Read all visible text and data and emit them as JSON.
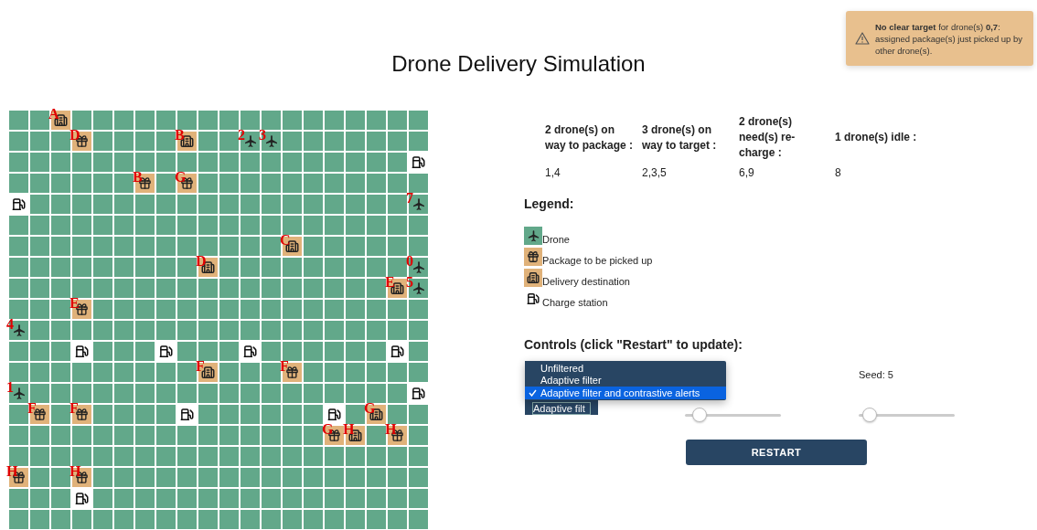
{
  "toast": {
    "message": "**No clear target** for drone(s) **0,7**: assigned package(s) just picked up by other drone(s)."
  },
  "title": "Drone Delivery Simulation",
  "grid": [
    [
      {
        "kind": "field"
      },
      {
        "kind": "field"
      },
      {
        "kind": "destination",
        "label": "A"
      },
      {
        "kind": "field"
      },
      {
        "kind": "field"
      },
      {
        "kind": "field"
      },
      {
        "kind": "field"
      },
      {
        "kind": "field"
      },
      {
        "kind": "field"
      },
      {
        "kind": "field"
      },
      {
        "kind": "field"
      },
      {
        "kind": "field"
      },
      {
        "kind": "field"
      },
      {
        "kind": "field"
      },
      {
        "kind": "field"
      },
      {
        "kind": "field"
      },
      {
        "kind": "field"
      },
      {
        "kind": "field"
      },
      {
        "kind": "field"
      },
      {
        "kind": "field"
      }
    ],
    [
      {
        "kind": "field"
      },
      {
        "kind": "field"
      },
      {
        "kind": "field"
      },
      {
        "kind": "package",
        "label": "D"
      },
      {
        "kind": "field"
      },
      {
        "kind": "field"
      },
      {
        "kind": "field"
      },
      {
        "kind": "field"
      },
      {
        "kind": "destination",
        "label": "B"
      },
      {
        "kind": "field"
      },
      {
        "kind": "field"
      },
      {
        "kind": "drone",
        "label": "2"
      },
      {
        "kind": "drone",
        "label": "3"
      },
      {
        "kind": "field"
      },
      {
        "kind": "field"
      },
      {
        "kind": "field"
      },
      {
        "kind": "field"
      },
      {
        "kind": "field"
      },
      {
        "kind": "field"
      },
      {
        "kind": "field"
      }
    ],
    [
      {
        "kind": "field"
      },
      {
        "kind": "field"
      },
      {
        "kind": "field"
      },
      {
        "kind": "field"
      },
      {
        "kind": "field"
      },
      {
        "kind": "field"
      },
      {
        "kind": "field"
      },
      {
        "kind": "field"
      },
      {
        "kind": "field"
      },
      {
        "kind": "field"
      },
      {
        "kind": "field"
      },
      {
        "kind": "field"
      },
      {
        "kind": "field"
      },
      {
        "kind": "field"
      },
      {
        "kind": "field"
      },
      {
        "kind": "field"
      },
      {
        "kind": "field"
      },
      {
        "kind": "field"
      },
      {
        "kind": "field"
      },
      {
        "kind": "charge"
      }
    ],
    [
      {
        "kind": "field"
      },
      {
        "kind": "field"
      },
      {
        "kind": "field"
      },
      {
        "kind": "field"
      },
      {
        "kind": "field"
      },
      {
        "kind": "field"
      },
      {
        "kind": "package",
        "label": "B"
      },
      {
        "kind": "field"
      },
      {
        "kind": "package",
        "label": "G"
      },
      {
        "kind": "field"
      },
      {
        "kind": "field"
      },
      {
        "kind": "field"
      },
      {
        "kind": "field"
      },
      {
        "kind": "field"
      },
      {
        "kind": "field"
      },
      {
        "kind": "field"
      },
      {
        "kind": "field"
      },
      {
        "kind": "field"
      },
      {
        "kind": "field"
      },
      {
        "kind": "field"
      }
    ],
    [
      {
        "kind": "charge"
      },
      {
        "kind": "field"
      },
      {
        "kind": "field"
      },
      {
        "kind": "field"
      },
      {
        "kind": "field"
      },
      {
        "kind": "field"
      },
      {
        "kind": "field"
      },
      {
        "kind": "field"
      },
      {
        "kind": "field"
      },
      {
        "kind": "field"
      },
      {
        "kind": "field"
      },
      {
        "kind": "field"
      },
      {
        "kind": "field"
      },
      {
        "kind": "field"
      },
      {
        "kind": "field"
      },
      {
        "kind": "field"
      },
      {
        "kind": "field"
      },
      {
        "kind": "field"
      },
      {
        "kind": "field"
      },
      {
        "kind": "drone",
        "label": "7"
      }
    ],
    [
      {
        "kind": "field"
      },
      {
        "kind": "field"
      },
      {
        "kind": "field"
      },
      {
        "kind": "field"
      },
      {
        "kind": "field"
      },
      {
        "kind": "field"
      },
      {
        "kind": "field"
      },
      {
        "kind": "field"
      },
      {
        "kind": "field"
      },
      {
        "kind": "field"
      },
      {
        "kind": "field"
      },
      {
        "kind": "field"
      },
      {
        "kind": "field"
      },
      {
        "kind": "field"
      },
      {
        "kind": "field"
      },
      {
        "kind": "field"
      },
      {
        "kind": "field"
      },
      {
        "kind": "field"
      },
      {
        "kind": "field"
      },
      {
        "kind": "field"
      }
    ],
    [
      {
        "kind": "field"
      },
      {
        "kind": "field"
      },
      {
        "kind": "field"
      },
      {
        "kind": "field"
      },
      {
        "kind": "field"
      },
      {
        "kind": "field"
      },
      {
        "kind": "field"
      },
      {
        "kind": "field"
      },
      {
        "kind": "field"
      },
      {
        "kind": "field"
      },
      {
        "kind": "field"
      },
      {
        "kind": "field"
      },
      {
        "kind": "field"
      },
      {
        "kind": "destination",
        "label": "C"
      },
      {
        "kind": "field"
      },
      {
        "kind": "field"
      },
      {
        "kind": "field"
      },
      {
        "kind": "field"
      },
      {
        "kind": "field"
      },
      {
        "kind": "field"
      }
    ],
    [
      {
        "kind": "field"
      },
      {
        "kind": "field"
      },
      {
        "kind": "field"
      },
      {
        "kind": "field"
      },
      {
        "kind": "field"
      },
      {
        "kind": "field"
      },
      {
        "kind": "field"
      },
      {
        "kind": "field"
      },
      {
        "kind": "field"
      },
      {
        "kind": "destination",
        "label": "D"
      },
      {
        "kind": "field"
      },
      {
        "kind": "field"
      },
      {
        "kind": "field"
      },
      {
        "kind": "field"
      },
      {
        "kind": "field"
      },
      {
        "kind": "field"
      },
      {
        "kind": "field"
      },
      {
        "kind": "field"
      },
      {
        "kind": "field"
      },
      {
        "kind": "drone",
        "label": "0"
      }
    ],
    [
      {
        "kind": "field"
      },
      {
        "kind": "field"
      },
      {
        "kind": "field"
      },
      {
        "kind": "field"
      },
      {
        "kind": "field"
      },
      {
        "kind": "field"
      },
      {
        "kind": "field"
      },
      {
        "kind": "field"
      },
      {
        "kind": "field"
      },
      {
        "kind": "field"
      },
      {
        "kind": "field"
      },
      {
        "kind": "field"
      },
      {
        "kind": "field"
      },
      {
        "kind": "field"
      },
      {
        "kind": "field"
      },
      {
        "kind": "field"
      },
      {
        "kind": "field"
      },
      {
        "kind": "field"
      },
      {
        "kind": "destination",
        "label": "E"
      },
      {
        "kind": "drone",
        "label": "5"
      }
    ],
    [
      {
        "kind": "field"
      },
      {
        "kind": "field"
      },
      {
        "kind": "field"
      },
      {
        "kind": "package",
        "label": "E"
      },
      {
        "kind": "field"
      },
      {
        "kind": "field"
      },
      {
        "kind": "field"
      },
      {
        "kind": "field"
      },
      {
        "kind": "field"
      },
      {
        "kind": "field"
      },
      {
        "kind": "field"
      },
      {
        "kind": "field"
      },
      {
        "kind": "field"
      },
      {
        "kind": "field"
      },
      {
        "kind": "field"
      },
      {
        "kind": "field"
      },
      {
        "kind": "field"
      },
      {
        "kind": "field"
      },
      {
        "kind": "field"
      },
      {
        "kind": "field"
      }
    ],
    [
      {
        "kind": "drone",
        "label": "4"
      },
      {
        "kind": "field"
      },
      {
        "kind": "field"
      },
      {
        "kind": "field"
      },
      {
        "kind": "field"
      },
      {
        "kind": "field"
      },
      {
        "kind": "field"
      },
      {
        "kind": "field"
      },
      {
        "kind": "field"
      },
      {
        "kind": "field"
      },
      {
        "kind": "field"
      },
      {
        "kind": "field"
      },
      {
        "kind": "field"
      },
      {
        "kind": "field"
      },
      {
        "kind": "field"
      },
      {
        "kind": "field"
      },
      {
        "kind": "field"
      },
      {
        "kind": "field"
      },
      {
        "kind": "field"
      },
      {
        "kind": "field"
      }
    ],
    [
      {
        "kind": "field"
      },
      {
        "kind": "field"
      },
      {
        "kind": "field"
      },
      {
        "kind": "charge"
      },
      {
        "kind": "field"
      },
      {
        "kind": "field"
      },
      {
        "kind": "field"
      },
      {
        "kind": "charge"
      },
      {
        "kind": "field"
      },
      {
        "kind": "field"
      },
      {
        "kind": "field"
      },
      {
        "kind": "charge"
      },
      {
        "kind": "field"
      },
      {
        "kind": "field"
      },
      {
        "kind": "field"
      },
      {
        "kind": "field"
      },
      {
        "kind": "field"
      },
      {
        "kind": "field"
      },
      {
        "kind": "charge"
      },
      {
        "kind": "field"
      }
    ],
    [
      {
        "kind": "field"
      },
      {
        "kind": "field"
      },
      {
        "kind": "field"
      },
      {
        "kind": "field"
      },
      {
        "kind": "field"
      },
      {
        "kind": "field"
      },
      {
        "kind": "field"
      },
      {
        "kind": "field"
      },
      {
        "kind": "field"
      },
      {
        "kind": "destination",
        "label": "F"
      },
      {
        "kind": "field"
      },
      {
        "kind": "field"
      },
      {
        "kind": "field"
      },
      {
        "kind": "package",
        "label": "F"
      },
      {
        "kind": "field"
      },
      {
        "kind": "field"
      },
      {
        "kind": "field"
      },
      {
        "kind": "field"
      },
      {
        "kind": "field"
      },
      {
        "kind": "field"
      }
    ],
    [
      {
        "kind": "drone",
        "label": "1"
      },
      {
        "kind": "field"
      },
      {
        "kind": "field"
      },
      {
        "kind": "field"
      },
      {
        "kind": "field"
      },
      {
        "kind": "field"
      },
      {
        "kind": "field"
      },
      {
        "kind": "field"
      },
      {
        "kind": "field"
      },
      {
        "kind": "field"
      },
      {
        "kind": "field"
      },
      {
        "kind": "field"
      },
      {
        "kind": "field"
      },
      {
        "kind": "field"
      },
      {
        "kind": "field"
      },
      {
        "kind": "field"
      },
      {
        "kind": "field"
      },
      {
        "kind": "field"
      },
      {
        "kind": "field"
      },
      {
        "kind": "charge"
      }
    ],
    [
      {
        "kind": "field"
      },
      {
        "kind": "package",
        "label": "F"
      },
      {
        "kind": "field"
      },
      {
        "kind": "package",
        "label": "F"
      },
      {
        "kind": "field"
      },
      {
        "kind": "field"
      },
      {
        "kind": "field"
      },
      {
        "kind": "field"
      },
      {
        "kind": "charge"
      },
      {
        "kind": "field"
      },
      {
        "kind": "field"
      },
      {
        "kind": "field"
      },
      {
        "kind": "field"
      },
      {
        "kind": "field"
      },
      {
        "kind": "field"
      },
      {
        "kind": "charge"
      },
      {
        "kind": "field"
      },
      {
        "kind": "destination",
        "label": "G"
      },
      {
        "kind": "field"
      },
      {
        "kind": "field"
      }
    ],
    [
      {
        "kind": "field"
      },
      {
        "kind": "field"
      },
      {
        "kind": "field"
      },
      {
        "kind": "field"
      },
      {
        "kind": "field"
      },
      {
        "kind": "field"
      },
      {
        "kind": "field"
      },
      {
        "kind": "field"
      },
      {
        "kind": "field"
      },
      {
        "kind": "field"
      },
      {
        "kind": "field"
      },
      {
        "kind": "field"
      },
      {
        "kind": "field"
      },
      {
        "kind": "field"
      },
      {
        "kind": "field"
      },
      {
        "kind": "package",
        "label": "G"
      },
      {
        "kind": "destination",
        "label": "H"
      },
      {
        "kind": "field"
      },
      {
        "kind": "package",
        "label": "H"
      },
      {
        "kind": "field"
      }
    ],
    [
      {
        "kind": "field"
      },
      {
        "kind": "field"
      },
      {
        "kind": "field"
      },
      {
        "kind": "field"
      },
      {
        "kind": "field"
      },
      {
        "kind": "field"
      },
      {
        "kind": "field"
      },
      {
        "kind": "field"
      },
      {
        "kind": "field"
      },
      {
        "kind": "field"
      },
      {
        "kind": "field"
      },
      {
        "kind": "field"
      },
      {
        "kind": "field"
      },
      {
        "kind": "field"
      },
      {
        "kind": "field"
      },
      {
        "kind": "field"
      },
      {
        "kind": "field"
      },
      {
        "kind": "field"
      },
      {
        "kind": "field"
      },
      {
        "kind": "field"
      }
    ],
    [
      {
        "kind": "package",
        "label": "H"
      },
      {
        "kind": "field"
      },
      {
        "kind": "field"
      },
      {
        "kind": "package",
        "label": "H"
      },
      {
        "kind": "field"
      },
      {
        "kind": "field"
      },
      {
        "kind": "field"
      },
      {
        "kind": "field"
      },
      {
        "kind": "field"
      },
      {
        "kind": "field"
      },
      {
        "kind": "field"
      },
      {
        "kind": "field"
      },
      {
        "kind": "field"
      },
      {
        "kind": "field"
      },
      {
        "kind": "field"
      },
      {
        "kind": "field"
      },
      {
        "kind": "field"
      },
      {
        "kind": "field"
      },
      {
        "kind": "field"
      },
      {
        "kind": "field"
      }
    ],
    [
      {
        "kind": "field"
      },
      {
        "kind": "field"
      },
      {
        "kind": "field"
      },
      {
        "kind": "charge"
      },
      {
        "kind": "field"
      },
      {
        "kind": "field"
      },
      {
        "kind": "field"
      },
      {
        "kind": "field"
      },
      {
        "kind": "field"
      },
      {
        "kind": "field"
      },
      {
        "kind": "field"
      },
      {
        "kind": "field"
      },
      {
        "kind": "field"
      },
      {
        "kind": "field"
      },
      {
        "kind": "field"
      },
      {
        "kind": "field"
      },
      {
        "kind": "field"
      },
      {
        "kind": "field"
      },
      {
        "kind": "field"
      },
      {
        "kind": "field"
      }
    ],
    [
      {
        "kind": "field"
      },
      {
        "kind": "field"
      },
      {
        "kind": "field"
      },
      {
        "kind": "field"
      },
      {
        "kind": "field"
      },
      {
        "kind": "field"
      },
      {
        "kind": "field"
      },
      {
        "kind": "field"
      },
      {
        "kind": "field"
      },
      {
        "kind": "field"
      },
      {
        "kind": "field"
      },
      {
        "kind": "field"
      },
      {
        "kind": "field"
      },
      {
        "kind": "field"
      },
      {
        "kind": "field"
      },
      {
        "kind": "field"
      },
      {
        "kind": "field"
      },
      {
        "kind": "field"
      },
      {
        "kind": "field"
      },
      {
        "kind": "field"
      }
    ]
  ],
  "status": [
    {
      "header": "2 drone(s) on way to package :",
      "drones": "1,4"
    },
    {
      "header": "3 drone(s) on way to target :",
      "drones": "2,3,5"
    },
    {
      "header": "2 drone(s) need(s) re-charge :",
      "drones": "6,9"
    },
    {
      "header": "1 drone(s) idle :",
      "drones": "8"
    }
  ],
  "legend": {
    "title": "Legend:",
    "items": [
      {
        "kind": "drone",
        "label": "Drone"
      },
      {
        "kind": "package",
        "label": "Package to be picked up"
      },
      {
        "kind": "destination",
        "label": "Delivery destination"
      },
      {
        "kind": "charge",
        "label": "Charge station"
      }
    ]
  },
  "controls": {
    "title": "Controls (click \"Restart\" to update):",
    "filter_select": {
      "value": "Adaptive filt",
      "options": [
        {
          "label": "Unfiltered",
          "selected": false
        },
        {
          "label": "Adaptive filter",
          "selected": false
        },
        {
          "label": "Adaptive filter and contrastive alerts",
          "selected": true
        }
      ]
    },
    "sliders": [
      {
        "level": 0.15
      },
      {
        "label": "Seed: 5",
        "level": 0.11
      }
    ],
    "restart_button": "RESTART"
  }
}
